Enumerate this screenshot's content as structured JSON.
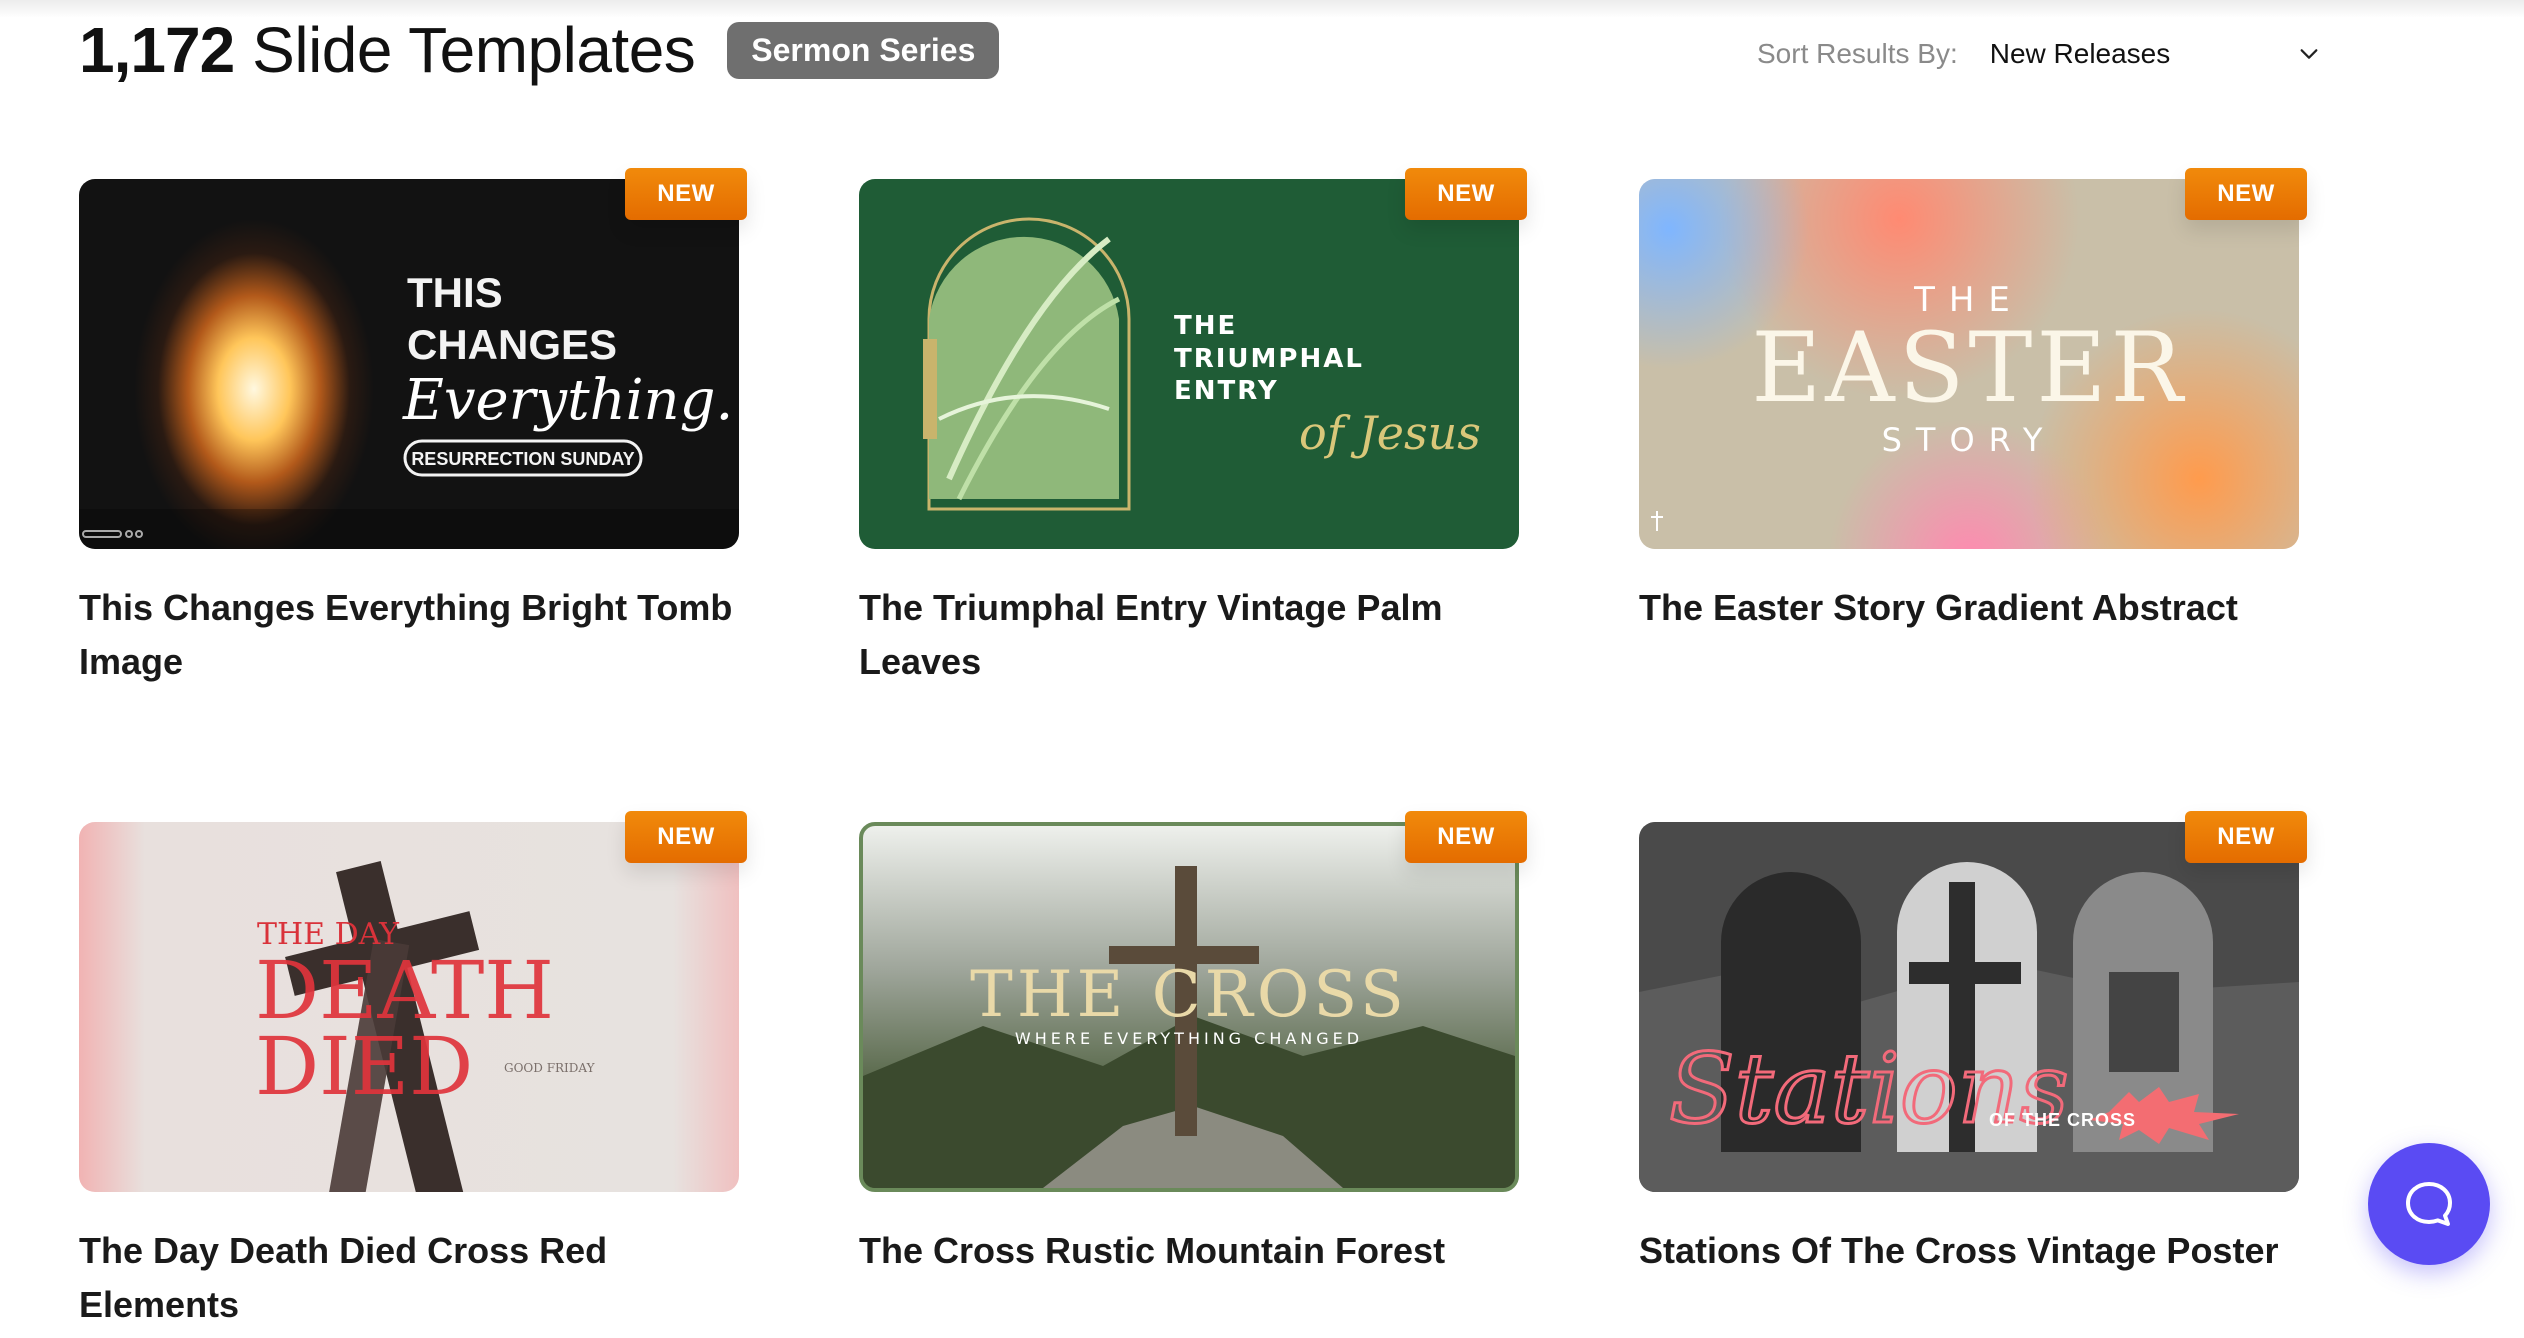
{
  "header": {
    "count": "1,172",
    "title_rest": "Slide Templates",
    "chip": "Sermon Series"
  },
  "sort": {
    "label": "Sort Results By:",
    "value": "New Releases"
  },
  "badge_label": "NEW",
  "cards": [
    {
      "title": "This Changes Everything Bright Tomb Image",
      "art": {
        "line1": "THIS",
        "line2": "CHANGES",
        "line3": "Everything.",
        "pill": "RESURRECTION SUNDAY"
      }
    },
    {
      "title": "The Triumphal Entry Vintage Palm Leaves",
      "art": {
        "line1": "THE",
        "line2": "TRIUMPHAL",
        "line3": "ENTRY",
        "script": "of Jesus"
      }
    },
    {
      "title": "The Easter Story Gradient Abstract",
      "art": {
        "line1": "THE",
        "line2": "EASTER",
        "line3": "STORY"
      }
    },
    {
      "title": "The Day Death Died Cross Red Elements",
      "art": {
        "line1": "THE DAY",
        "line2": "DEATH",
        "line3": "DIED",
        "small": "GOOD FRIDAY"
      }
    },
    {
      "title": "The Cross Rustic Mountain Forest",
      "art": {
        "line1": "THE CROSS",
        "line2": "WHERE EVERYTHING CHANGED"
      }
    },
    {
      "title": "Stations Of The Cross Vintage Poster",
      "art": {
        "line1": "Stations",
        "line2": "OF THE CROSS"
      }
    }
  ],
  "colors": {
    "badge": "#ef7d05",
    "chip": "#6f6f6f",
    "chat_button": "#5a4bf3"
  }
}
